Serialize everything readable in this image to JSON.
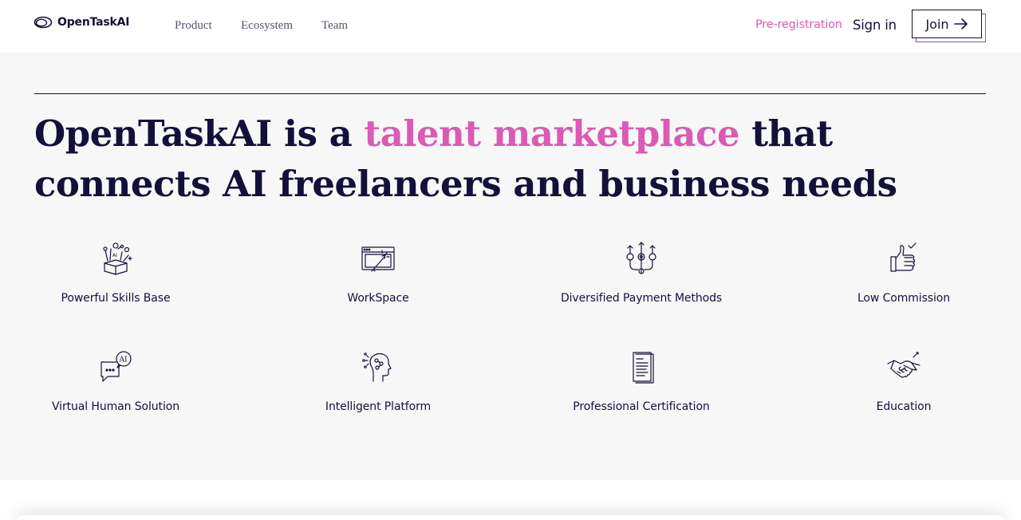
{
  "header": {
    "logo_text": "OpenTaskAI",
    "nav": [
      "Product",
      "Ecosystem",
      "Team"
    ],
    "preregistration": "Pre-registration",
    "signin": "Sign in",
    "join": "Join"
  },
  "hero": {
    "headline_before": "OpenTaskAI is a ",
    "headline_highlight": "talent marketplace",
    "headline_after": " that connects AI freelancers and business needs"
  },
  "features": [
    {
      "label": "Powerful Skills Base",
      "icon": "skills-box-icon"
    },
    {
      "label": "WorkSpace",
      "icon": "workspace-window-icon"
    },
    {
      "label": "Diversified Payment Methods",
      "icon": "payment-methods-icon"
    },
    {
      "label": "Low Commission",
      "icon": "thumbs-up-icon"
    },
    {
      "label": "Virtual Human Solution",
      "icon": "ai-chat-icon"
    },
    {
      "label": "Intelligent Platform",
      "icon": "ai-head-icon"
    },
    {
      "label": "Professional Certification",
      "icon": "certificate-document-icon"
    },
    {
      "label": "Education",
      "icon": "handshake-icon"
    }
  ],
  "colors": {
    "accent_pink": "#d95bb3",
    "navy": "#13103a",
    "section_bg": "#f7f7f7",
    "join_shadow_purple": "#8e4fa6"
  }
}
